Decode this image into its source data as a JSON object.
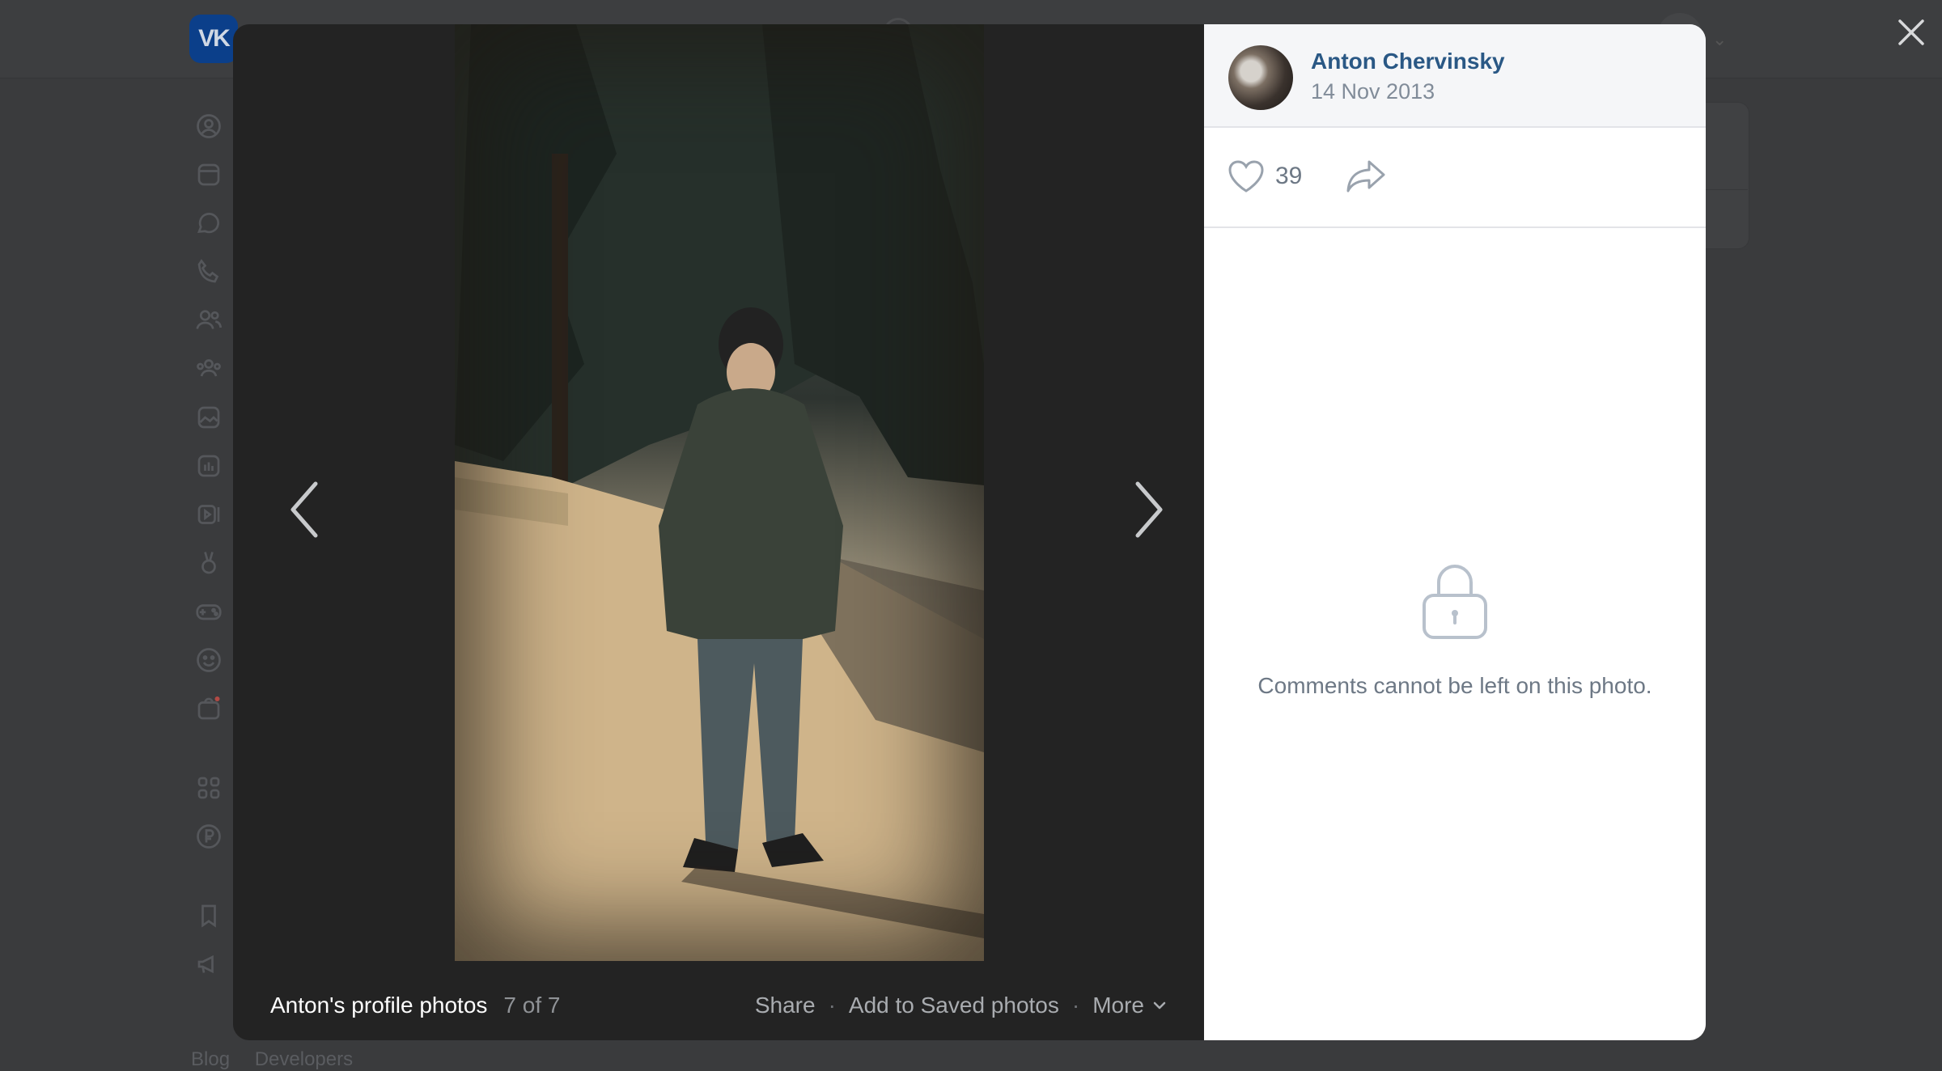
{
  "viewer": {
    "author_name": "Anton Chervinsky",
    "date": "14 Nov 2013",
    "likes": "39",
    "album_title": "Anton's profile photos",
    "counter": "7 of 7",
    "actions": {
      "share": "Share",
      "save": "Add to Saved photos",
      "more": "More"
    },
    "comments_locked_text": "Comments cannot be left on this photo."
  },
  "background": {
    "footer_links": [
      "Blog",
      "Developers"
    ]
  },
  "icons": {
    "close": "close-icon",
    "prev": "chevron-left-icon",
    "next": "chevron-right-icon",
    "like": "heart-icon",
    "share": "share-arrow-icon",
    "lock": "lock-icon",
    "more": "chevron-down-icon"
  }
}
